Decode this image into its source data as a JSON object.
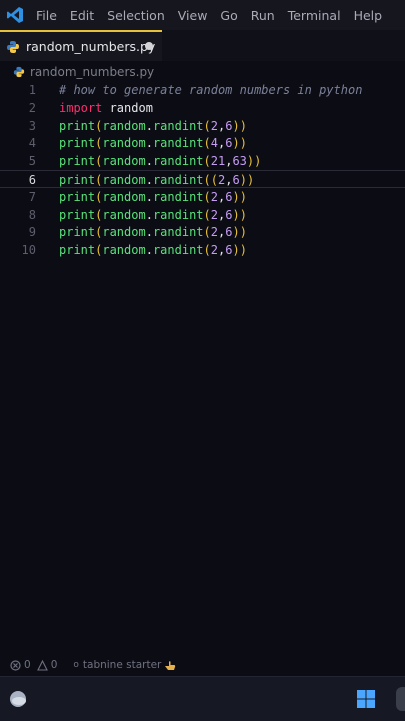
{
  "menu": [
    "File",
    "Edit",
    "Selection",
    "View",
    "Go",
    "Run",
    "Terminal",
    "Help"
  ],
  "tab": {
    "label": "random_numbers.py"
  },
  "breadcrumb": {
    "label": "random_numbers.py"
  },
  "editor": {
    "current_line": 6,
    "lines": [
      {
        "n": "1",
        "text": "# how to generate random numbers in python"
      },
      {
        "n": "2",
        "text": "import random"
      },
      {
        "n": "3",
        "text": "print(random.randint(2,6))"
      },
      {
        "n": "4",
        "text": "print(random.randint(4,6))"
      },
      {
        "n": "5",
        "text": "print(random.randint(21,63))"
      },
      {
        "n": "6",
        "text": "print(random.randint((2,6))"
      },
      {
        "n": "7",
        "text": "print(random.randint(2,6))"
      },
      {
        "n": "8",
        "text": "print(random.randint(2,6))"
      },
      {
        "n": "9",
        "text": "print(random.randint(2,6))"
      },
      {
        "n": "10",
        "text": "print(random.randint(2,6))"
      }
    ]
  },
  "status": {
    "errors": "0",
    "warnings": "0",
    "tabnine": "tabnine starter"
  },
  "colors": {
    "accent": "#e8c13a",
    "keyword": "#ff2d6e",
    "function": "#59e37a",
    "number": "#c59df3"
  },
  "icons": [
    "vscode-logo-icon",
    "python-file-icon",
    "error-icon",
    "warning-icon",
    "weather-icon",
    "windows-start-icon"
  ]
}
